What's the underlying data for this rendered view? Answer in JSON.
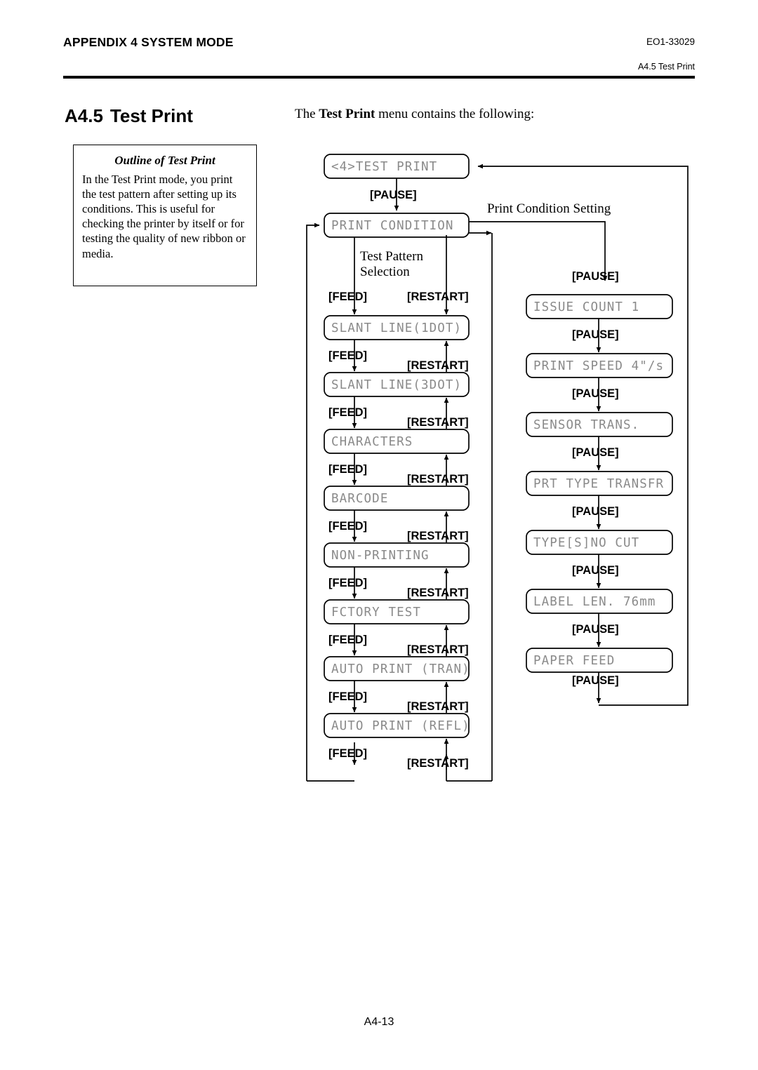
{
  "header": {
    "appendix": "APPENDIX 4 SYSTEM MODE",
    "doc_number": "EO1-33029",
    "section_ref": "A4.5 Test Print"
  },
  "section": {
    "number": "A4.5",
    "title": "Test Print"
  },
  "outline": {
    "title": "Outline of Test Print",
    "body": "In the Test Print mode, you print the test pattern after setting up its conditions. This is useful for checking the printer by itself or for testing the quality of new ribbon or media."
  },
  "intro": {
    "prefix": "The ",
    "bold": "Test Print",
    "suffix": " menu contains the following:"
  },
  "flow": {
    "root_box": "<4>TEST PRINT",
    "condition_box": "PRINT CONDITION",
    "annotations": {
      "print_condition_setting": "Print Condition Setting",
      "test_pattern_line1": "Test Pattern",
      "test_pattern_line2": "Selection"
    },
    "keys": {
      "pause": "[PAUSE]",
      "feed": "[FEED]",
      "restart": "[RESTART]"
    },
    "test_pattern_items": [
      "SLANT LINE(1DOT)",
      "SLANT LINE(3DOT)",
      "CHARACTERS",
      "BARCODE",
      "NON-PRINTING",
      "FCTORY TEST",
      "AUTO PRINT (TRAN)",
      "AUTO PRINT (REFL)"
    ],
    "print_condition_items": [
      "ISSUE COUNT 1",
      "PRINT SPEED 4\"/s",
      "SENSOR TRANS.",
      "PRT TYPE TRANSFR",
      "TYPE[S]NO CUT",
      "LABEL LEN.  76mm",
      "PAPER FEED"
    ]
  },
  "footer": {
    "page": "A4-13"
  },
  "colors": {
    "lcd_text": "#8a8a8a",
    "line": "#000000",
    "paper": "#ffffff"
  }
}
